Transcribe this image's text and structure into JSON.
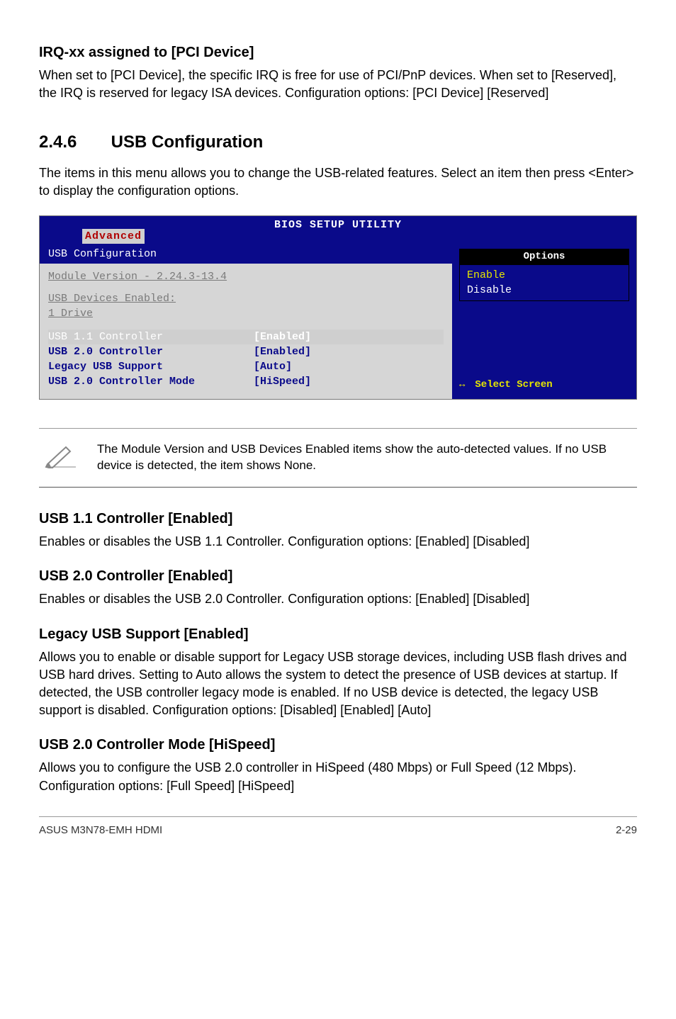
{
  "sections": {
    "irq": {
      "heading": "IRQ-xx assigned to [PCI Device]",
      "text": "When set to [PCI Device], the specific IRQ is free for use of PCI/PnP devices. When set to [Reserved], the IRQ is reserved for legacy ISA devices. Configuration options: [PCI Device] [Reserved]"
    },
    "usb_config": {
      "number": "2.4.6",
      "title": "USB Configuration",
      "intro": "The items in this menu allows you to change the USB-related features. Select an item then press <Enter> to display the configuration options."
    },
    "usb11": {
      "heading": "USB 1.1 Controller [Enabled]",
      "text": "Enables or disables the USB 1.1 Controller. Configuration options: [Enabled] [Disabled]"
    },
    "usb20": {
      "heading": "USB 2.0 Controller [Enabled]",
      "text": "Enables or disables the USB 2.0 Controller. Configuration options:  [Enabled] [Disabled]"
    },
    "legacy": {
      "heading": "Legacy USB Support [Enabled]",
      "text": "Allows you to enable or disable support for Legacy USB storage devices, including USB flash drives and USB hard drives. Setting to Auto allows the system to detect the presence of USB devices at startup. If detected, the USB controller legacy mode is enabled. If no USB device is detected, the legacy USB support is disabled. Configuration options: [Disabled] [Enabled] [Auto]"
    },
    "usb20mode": {
      "heading": "USB 2.0 Controller Mode [HiSpeed]",
      "text": "Allows you to configure the USB 2.0 controller in HiSpeed (480 Mbps) or Full Speed (12 Mbps). Configuration options: [Full Speed] [HiSpeed]"
    }
  },
  "bios": {
    "title": "BIOS SETUP UTILITY",
    "tab": "Advanced",
    "page_header": "USB Configuration",
    "module_line": "Module Version - 2.24.3-13.4",
    "devices_label": "USB Devices Enabled:",
    "devices_value": " 1 Drive",
    "items": [
      {
        "label": "USB 1.1 Controller",
        "value": "[Enabled]",
        "selected": true
      },
      {
        "label": "USB 2.0 Controller",
        "value": "[Enabled]",
        "selected": false
      },
      {
        "label": "Legacy USB Support",
        "value": "[Auto]",
        "selected": false
      },
      {
        "label": "USB 2.0 Controller Mode",
        "value": "[HiSpeed]",
        "selected": false
      }
    ],
    "options_header": "Options",
    "options": {
      "enable": "Enable",
      "disable": "Disable"
    },
    "help_arrow": "↔",
    "help_text": "Select Screen"
  },
  "note": {
    "text": "The Module Version and USB Devices Enabled items show the auto-detected values. If no USB device is detected, the item shows None."
  },
  "footer": {
    "left": "ASUS M3N78-EMH HDMI",
    "right": "2-29"
  }
}
